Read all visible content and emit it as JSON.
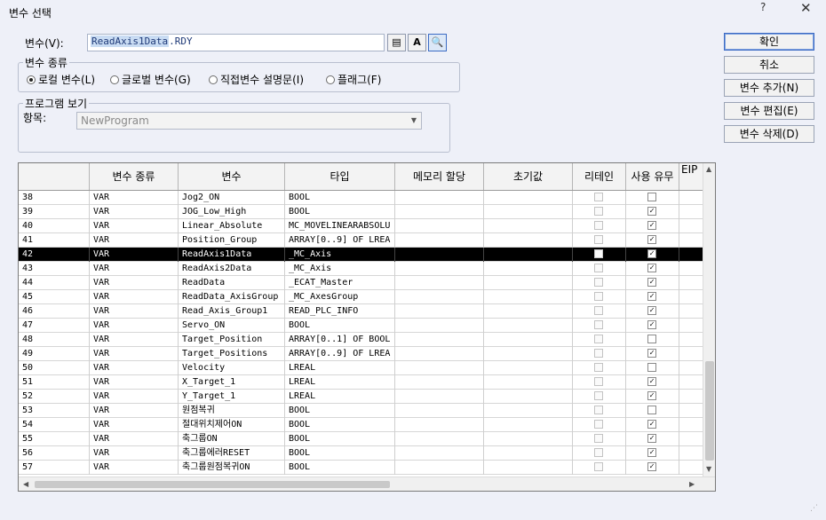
{
  "window": {
    "title": "변수 선택",
    "help": "?",
    "close": "✕"
  },
  "variable": {
    "label": "변수(V):",
    "value": "ReadAxis1Data.RDY",
    "value_selected": "ReadAxis1Data",
    "value_rest": ".RDY"
  },
  "icons": {
    "btn1": "▤",
    "btn2": "A",
    "btn3": "🔍"
  },
  "var_kind": {
    "title": "변수 종류",
    "options": [
      {
        "label": "로컬 변수(L)",
        "selected": true
      },
      {
        "label": "글로벌 변수(G)",
        "selected": false
      },
      {
        "label": "직접변수 설명문(I)",
        "selected": false
      },
      {
        "label": "플래그(F)",
        "selected": false
      }
    ]
  },
  "program_view": {
    "title": "프로그램 보기",
    "item_label": "항목:",
    "value": "NewProgram"
  },
  "buttons": {
    "ok": "확인",
    "cancel": "취소",
    "add": "변수 추가(N)",
    "edit": "변수 편집(E)",
    "delete": "변수 삭제(D)"
  },
  "table": {
    "columns": [
      "",
      "변수 종류",
      "변수",
      "타입",
      "메모리 할당",
      "초기값",
      "리테인",
      "사용 유무",
      "EIP"
    ],
    "selected_row": "42",
    "rows": [
      {
        "no": "38",
        "kind": "VAR",
        "name": "Jog2_ON",
        "type": "BOOL",
        "retain": false,
        "used": false
      },
      {
        "no": "39",
        "kind": "VAR",
        "name": "JOG_Low_High",
        "type": "BOOL",
        "retain": false,
        "used": true
      },
      {
        "no": "40",
        "kind": "VAR",
        "name": "Linear_Absolute",
        "type": "MC_MOVELINEARABSOLU",
        "retain": false,
        "used": true
      },
      {
        "no": "41",
        "kind": "VAR",
        "name": "Position_Group",
        "type": "ARRAY[0..9] OF LREA",
        "retain": false,
        "used": true
      },
      {
        "no": "42",
        "kind": "VAR",
        "name": "ReadAxis1Data",
        "type": "_MC_Axis",
        "retain": false,
        "used": true
      },
      {
        "no": "43",
        "kind": "VAR",
        "name": "ReadAxis2Data",
        "type": "_MC_Axis",
        "retain": false,
        "used": true
      },
      {
        "no": "44",
        "kind": "VAR",
        "name": "ReadData",
        "type": "_ECAT_Master",
        "retain": false,
        "used": true
      },
      {
        "no": "45",
        "kind": "VAR",
        "name": "ReadData_AxisGroup",
        "type": "_MC_AxesGroup",
        "retain": false,
        "used": true
      },
      {
        "no": "46",
        "kind": "VAR",
        "name": "Read_Axis_Group1",
        "type": "READ_PLC_INFO",
        "retain": false,
        "used": true
      },
      {
        "no": "47",
        "kind": "VAR",
        "name": "Servo_ON",
        "type": "BOOL",
        "retain": false,
        "used": true
      },
      {
        "no": "48",
        "kind": "VAR",
        "name": "Target_Position",
        "type": "ARRAY[0..1] OF BOOL",
        "retain": false,
        "used": false
      },
      {
        "no": "49",
        "kind": "VAR",
        "name": "Target_Positions",
        "type": "ARRAY[0..9] OF LREA",
        "retain": false,
        "used": true
      },
      {
        "no": "50",
        "kind": "VAR",
        "name": "Velocity",
        "type": "LREAL",
        "retain": false,
        "used": false
      },
      {
        "no": "51",
        "kind": "VAR",
        "name": "X_Target_1",
        "type": "LREAL",
        "retain": false,
        "used": true
      },
      {
        "no": "52",
        "kind": "VAR",
        "name": "Y_Target_1",
        "type": "LREAL",
        "retain": false,
        "used": true
      },
      {
        "no": "53",
        "kind": "VAR",
        "name": "원점복귀",
        "type": "BOOL",
        "retain": false,
        "used": false
      },
      {
        "no": "54",
        "kind": "VAR",
        "name": "절대위치제어ON",
        "type": "BOOL",
        "retain": false,
        "used": true
      },
      {
        "no": "55",
        "kind": "VAR",
        "name": "축그룹ON",
        "type": "BOOL",
        "retain": false,
        "used": true
      },
      {
        "no": "56",
        "kind": "VAR",
        "name": "축그룹에러RESET",
        "type": "BOOL",
        "retain": false,
        "used": true
      },
      {
        "no": "57",
        "kind": "VAR",
        "name": "축그룹원점복귀ON",
        "type": "BOOL",
        "retain": false,
        "used": true
      }
    ]
  }
}
